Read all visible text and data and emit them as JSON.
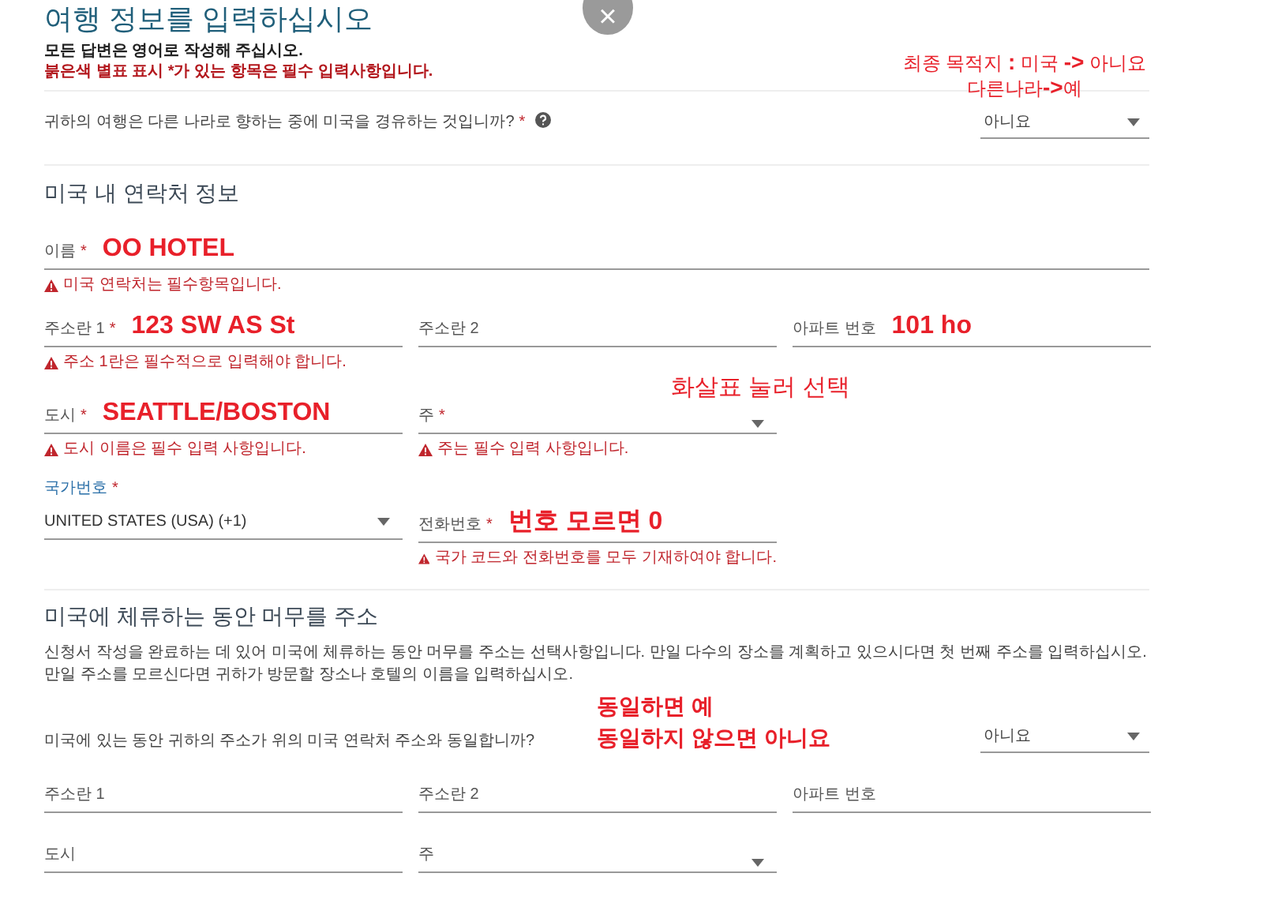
{
  "title": "여행 정보를 입력하십시오",
  "close": "×",
  "intro": [
    "모든 답변은 영어로 작성해 주십시오.",
    "붉은색 별표 표시 *가 있는 항목은 필수 입력사항입니다."
  ],
  "question_1": {
    "text": "귀하의 여행은 다른 나라로 향하는 중에 미국을 경유하는 것입니까?",
    "asterisk": "*",
    "value": "아니요",
    "notes": [
      "최종 목적지 **:** 미국 **->** 아니요",
      "다른나라**->**예"
    ]
  },
  "section_1": {
    "heading": "미국 내 연락처 정보",
    "rows": [
      [
        {
          "kind": "input",
          "label": "이름",
          "asterisk": "*",
          "note": "OO HOTEL",
          "error": "미국 연락처는 필수항목입니다."
        }
      ],
      [
        {
          "kind": "input",
          "label": "주소란 1",
          "asterisk": "*",
          "note": "123 SW AS St",
          "error": "주소 1란은 필수적으로 입력해야 합니다."
        },
        {
          "kind": "input",
          "label": "주소란 2"
        },
        {
          "kind": "input",
          "label": "아파트 번호",
          "note": "101 ho"
        }
      ],
      [
        {
          "kind": "input",
          "label": "도시",
          "asterisk": "*",
          "note": "SEATTLE/BOSTON",
          "error": "도시 이름은 필수 입력 사항입니다."
        },
        {
          "kind": "select",
          "label": "주",
          "asterisk": "*",
          "note": "화살표 눌러 선택",
          "error": "주는 필수 입력 사항입니다."
        }
      ],
      [
        {
          "kind": "select",
          "label": "국가번호",
          "asterisk": "*",
          "value": "UNITED STATES (USA) (+1)",
          "focused": true
        },
        {
          "kind": "input",
          "label": "전화번호",
          "asterisk": "*",
          "note": "번호 모르면 0",
          "error": "국가 코드와 전화번호를 모두 기재하여야 합니다."
        }
      ]
    ]
  },
  "section_2": {
    "heading": "미국에 체류하는 동안 머무를 주소",
    "description": "신청서 작성을 완료하는 데 있어 미국에 체류하는 동안 머무를 주소는 선택사항입니다. 만일 다수의 장소를 계획하고 있으시다면 첫 번째 주소를 입력하십시오. 만일 주소를 모르신다면 귀하가 방문할 장소나 호텔의 이름을 입력하십시오.",
    "question": {
      "text": "미국에 있는 동안 귀하의 주소가 위의 미국 연락처 주소와 동일합니까?",
      "value": "아니요",
      "notes": [
        "동일하면 예",
        "동일하지 않으면 아니요"
      ]
    },
    "rows": [
      [
        {
          "kind": "input",
          "label": "주소란 1"
        },
        {
          "kind": "input",
          "label": "주소란 2"
        },
        {
          "kind": "input",
          "label": "아파트 번호"
        }
      ],
      [
        {
          "kind": "input",
          "label": "도시"
        },
        {
          "kind": "select",
          "label": "주"
        }
      ]
    ]
  }
}
